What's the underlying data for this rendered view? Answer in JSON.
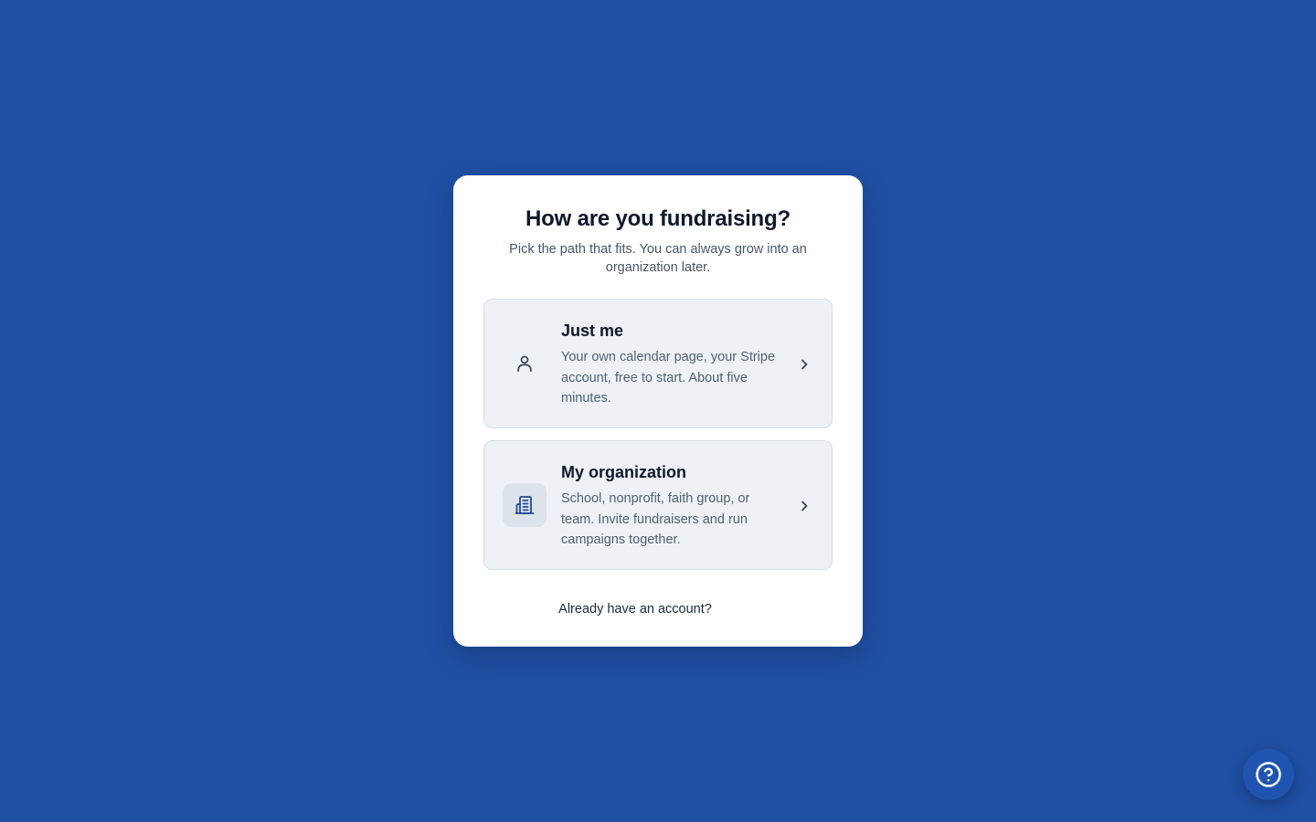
{
  "heading": {
    "title": "How are you fundraising?",
    "subtitle": "Pick the path that fits. You can always grow into an organization later."
  },
  "options": [
    {
      "title": "Just me",
      "description": "Your own calendar page, your Stripe account, free to start. About five minutes.",
      "icon": "person-icon"
    },
    {
      "title": "My organization",
      "description": "School, nonprofit, faith group, or team. Invite fundraisers and run campaigns together.",
      "icon": "building-icon"
    }
  ],
  "footer": {
    "signin_link": "Already have an account?"
  },
  "help": {
    "icon": "help-icon"
  },
  "colors": {
    "background": "#1f4fa3",
    "card": "#ffffff",
    "option_bg": "#eef2f6",
    "accent": "#1e4b9b"
  }
}
